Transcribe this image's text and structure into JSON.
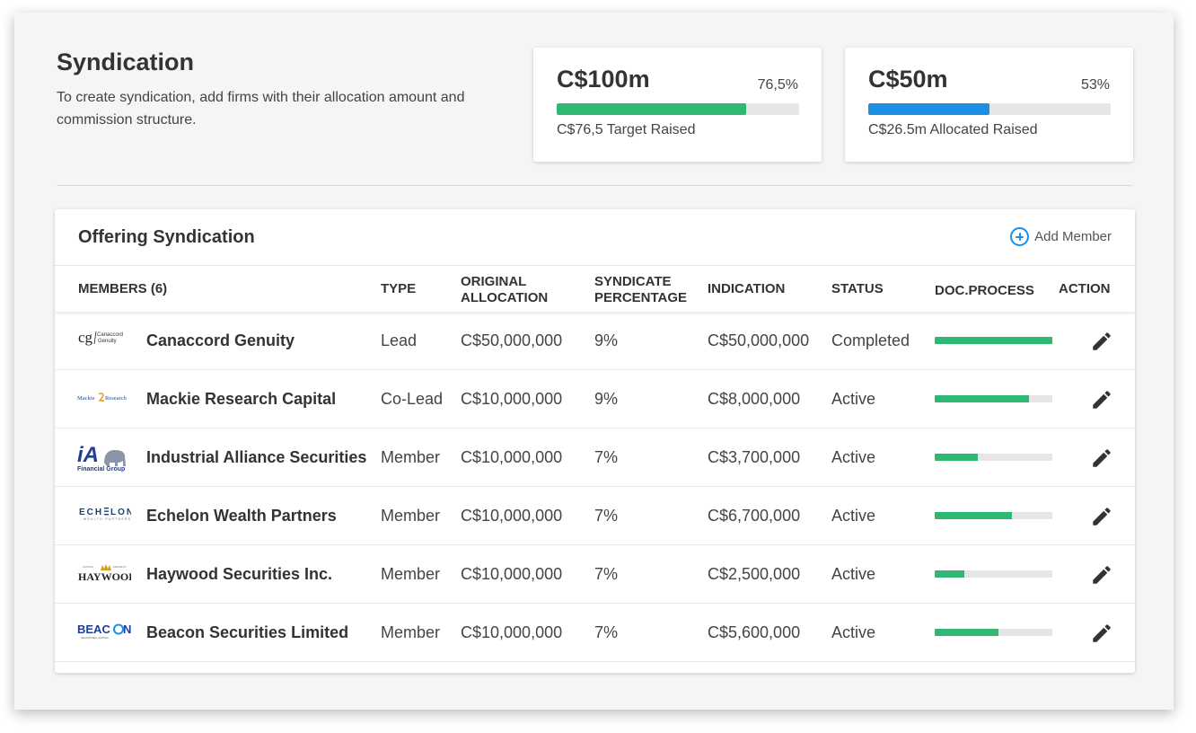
{
  "header": {
    "title": "Syndication",
    "description": "To create syndication, add firms with their allocation amount and commission structure."
  },
  "stats": [
    {
      "amount": "C$100m",
      "percent": "76,5%",
      "caption": "C$76,5 Target Raised",
      "progress": 0.78,
      "color": "#2eb873"
    },
    {
      "amount": "C$50m",
      "percent": "53%",
      "caption": "C$26.5m Allocated Raised",
      "progress": 0.5,
      "color": "#1a8fe3"
    }
  ],
  "offering": {
    "title": "Offering Syndication",
    "add_label": "Add Member",
    "columns": {
      "members": "MEMBERS (6)",
      "type": "TYPE",
      "original_allocation": "ORIGINAL\nALLOCATION",
      "syndicate_percentage": "SYNDICATE\nPERCENTAGE",
      "indication": "INDICATION",
      "status": "STATUS",
      "doc_process": "DOC.PROCESS",
      "action": "ACTION"
    },
    "rows": [
      {
        "logo": "Canaccord Genuity",
        "name": "Canaccord Genuity",
        "type": "Lead",
        "allocation": "C$50,000,000",
        "percentage": "9%",
        "indication": "C$50,000,000",
        "status": "Completed",
        "doc_progress": 1.0
      },
      {
        "logo": "Mackie Research",
        "name": "Mackie Research Capital",
        "type": "Co-Lead",
        "allocation": "C$10,000,000",
        "percentage": "9%",
        "indication": "C$8,000,000",
        "status": "Active",
        "doc_progress": 0.8
      },
      {
        "logo": "iA Financial Group",
        "name": "Industrial Alliance Securities",
        "type": "Member",
        "allocation": "C$10,000,000",
        "percentage": "7%",
        "indication": "C$3,700,000",
        "status": "Active",
        "doc_progress": 0.37
      },
      {
        "logo": "ECHELON WEALTH PARTNERS",
        "name": "Echelon Wealth Partners",
        "type": "Member",
        "allocation": "C$10,000,000",
        "percentage": "7%",
        "indication": "C$6,700,000",
        "status": "Active",
        "doc_progress": 0.66
      },
      {
        "logo": "HAYWOOD",
        "name": "Haywood Securities Inc.",
        "type": "Member",
        "allocation": "C$10,000,000",
        "percentage": "7%",
        "indication": "C$2,500,000",
        "status": "Active",
        "doc_progress": 0.25
      },
      {
        "logo": "BEACON",
        "name": "Beacon Securities Limited",
        "type": "Member",
        "allocation": "C$10,000,000",
        "percentage": "7%",
        "indication": "C$5,600,000",
        "status": "Active",
        "doc_progress": 0.54
      }
    ]
  }
}
